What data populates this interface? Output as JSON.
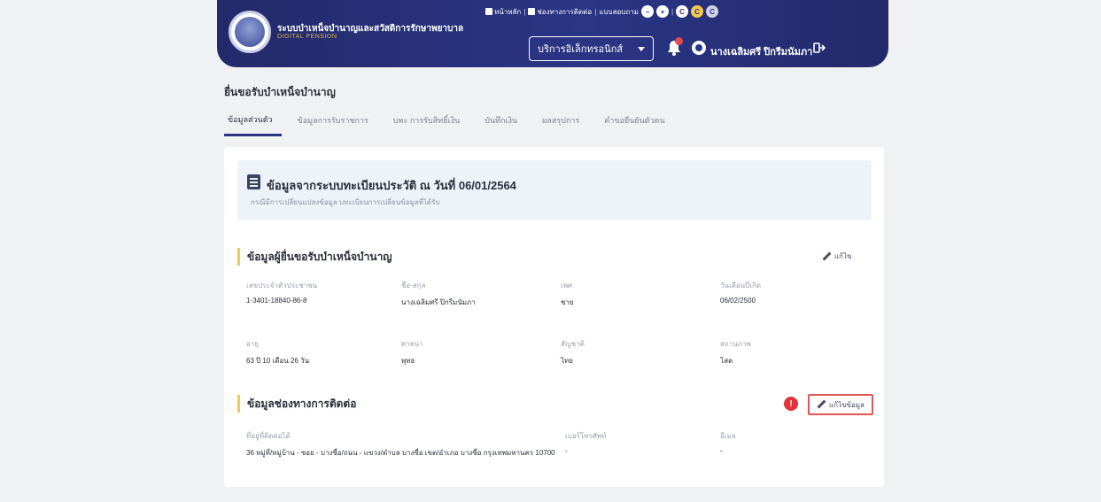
{
  "header": {
    "brand_title": "ระบบบำเหน็จบำนาญและสวัสดิการรักษาพยาบาล",
    "brand_subtitle": "DIGITAL PENSION",
    "top_links": [
      "หน้าหลัก",
      "ช่องทางการติดต่อ",
      "แบบสอบถาม"
    ],
    "service_select": "บริการอิเล็กทรอนิกส์",
    "user_name": "นางเฉลิมศรี ปิกรีมนัมภา"
  },
  "page": {
    "title": "ยื่นขอรับบำเหน็จบำนาญ",
    "tabs": [
      "ข้อมูลส่วนตัว",
      "ข้อมูลการรับราชการ",
      "บทะ การรับสิทธิ์เงิน",
      "บันทึกเงิน",
      "ผลสรุปการ",
      "คำขอยืนยันตัวตน"
    ]
  },
  "registry_box": {
    "title": "ข้อมูลจากระบบทะเบียนประวัติ ณ วันที่ 06/01/2564",
    "subtitle": "กรณีมีการเปลี่ยนแปลงข้อมูล บทะเบียนการเปลี่ยนข้อมูลที่ได้รับ"
  },
  "applicant_section": {
    "heading": "ข้อมูลผู้ยื่นขอรับบำเหน็จบำนาญ",
    "edit_label": "แก้ไข",
    "fields": [
      {
        "label": "เลขประจำตัวประชาชน",
        "value": "1-3401-18840-86-8"
      },
      {
        "label": "ชื่อ-สกุล",
        "value": "นางเฉลิมศรี ปิกรีมนัมภา"
      },
      {
        "label": "เพศ",
        "value": "ชาย"
      },
      {
        "label": "วันเดือนปีเกิด",
        "value": "06/02/2500"
      },
      {
        "label": "อายุ",
        "value": "63 ปี 10 เดือน 26 วัน"
      },
      {
        "label": "ศาสนา",
        "value": "พุทธ"
      },
      {
        "label": "สัญชาติ",
        "value": "ไทย"
      },
      {
        "label": "สถานภาพ",
        "value": "โสด"
      }
    ]
  },
  "contact_section": {
    "heading": "ข้อมูลช่องทางการติดต่อ",
    "alert_badge": "!",
    "edit_label": "แก้ไขข้อมูล",
    "fields": [
      {
        "label": "ที่อยู่ที่ติดต่อได้",
        "value": "36 หมู่ที่/หมู่บ้าน - ซอย - บางซื่อ/ถนน - แขวง/ตำบล บางซื่อ เขต/อำเภอ บางซื่อ กรุงเทพมหานคร 10700"
      },
      {
        "label": "เบอร์โทรศัพท์",
        "value": "-"
      },
      {
        "label": "อีเมล",
        "value": "-"
      }
    ]
  }
}
